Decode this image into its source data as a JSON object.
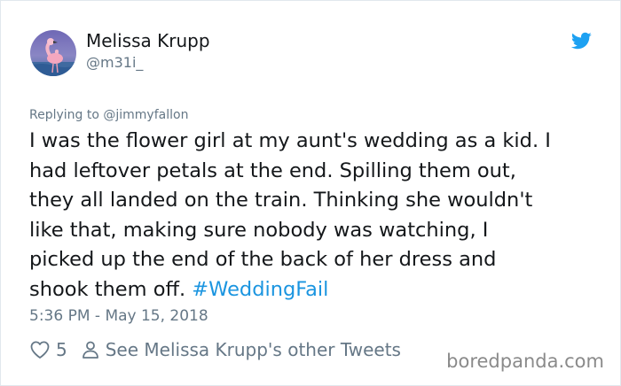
{
  "author": {
    "display_name": "Melissa Krupp",
    "handle": "@m31i_"
  },
  "reply_to": "Replying to @jimmyfallon",
  "tweet": {
    "lines": [
      "I was the flower girl at my aunt's wedding as a kid. I",
      "had leftover petals at the end. Spilling them out,",
      "they all landed on the train. Thinking she wouldn't",
      "like that, making sure nobody was watching, I",
      "picked up the end of the back of her dress and"
    ],
    "last_line_text": "shook them off.",
    "hashtag": "#WeddingFail"
  },
  "timestamp": "5:36 PM - May 15, 2018",
  "actions": {
    "likes": "5",
    "other_tweets_label": "See Melissa Krupp's other Tweets"
  },
  "watermark": "boredpanda.com",
  "icons": {
    "avatar": "avatar",
    "logo": "twitter-bird-icon",
    "like": "heart-icon",
    "profile": "person-icon"
  },
  "colors": {
    "text": "#14171a",
    "muted": "#657786",
    "link": "#1b95e0",
    "twitter_blue": "#1da1f2",
    "watermark": "#8a8a8a"
  }
}
